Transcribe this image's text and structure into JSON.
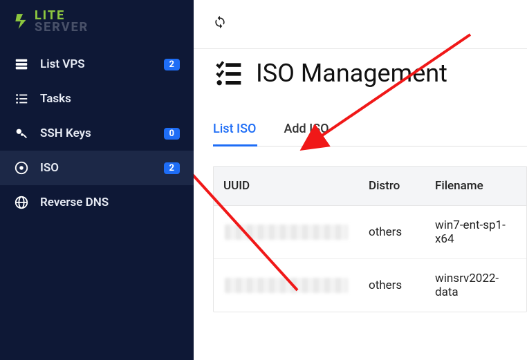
{
  "logo": {
    "line1": "LITE",
    "line2": "SERVER"
  },
  "sidebar": {
    "items": [
      {
        "label": "List VPS",
        "badge": "2"
      },
      {
        "label": "Tasks",
        "badge": null
      },
      {
        "label": "SSH Keys",
        "badge": "0"
      },
      {
        "label": "ISO",
        "badge": "2"
      },
      {
        "label": "Reverse DNS",
        "badge": null
      }
    ]
  },
  "page": {
    "title": "ISO Management"
  },
  "tabs": {
    "list": "List ISO",
    "add": "Add ISO"
  },
  "table": {
    "headers": {
      "uuid": "UUID",
      "distro": "Distro",
      "file": "Filename"
    },
    "rows": [
      {
        "distro": "others",
        "file": "win7-ent-sp1-x64"
      },
      {
        "distro": "others",
        "file": "winsrv2022-data"
      }
    ]
  }
}
